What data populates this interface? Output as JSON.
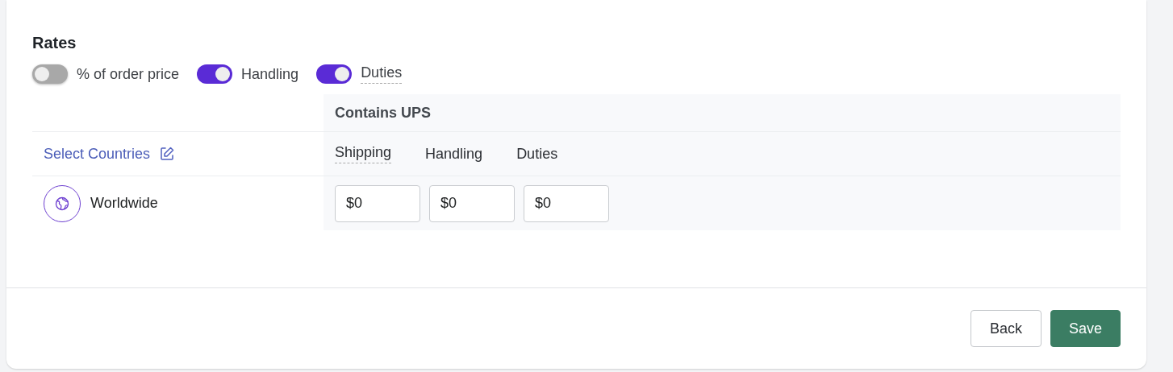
{
  "section_title": "Rates",
  "toggles": [
    {
      "label": "% of order price",
      "on": false,
      "tooltip": false
    },
    {
      "label": "Handling",
      "on": true,
      "tooltip": false
    },
    {
      "label": "Duties",
      "on": true,
      "tooltip": true
    }
  ],
  "table": {
    "carrier_heading": "Contains UPS",
    "select_link": "Select Countries",
    "columns": [
      {
        "label": "Shipping",
        "tooltip": true
      },
      {
        "label": "Handling",
        "tooltip": false
      },
      {
        "label": "Duties",
        "tooltip": false
      }
    ],
    "rows": [
      {
        "region": "Worldwide",
        "values": [
          "$0",
          "$0",
          "$0"
        ]
      }
    ]
  },
  "buttons": [
    {
      "label": "Back",
      "kind": "secondary"
    },
    {
      "label": "Save",
      "kind": "primary"
    }
  ]
}
